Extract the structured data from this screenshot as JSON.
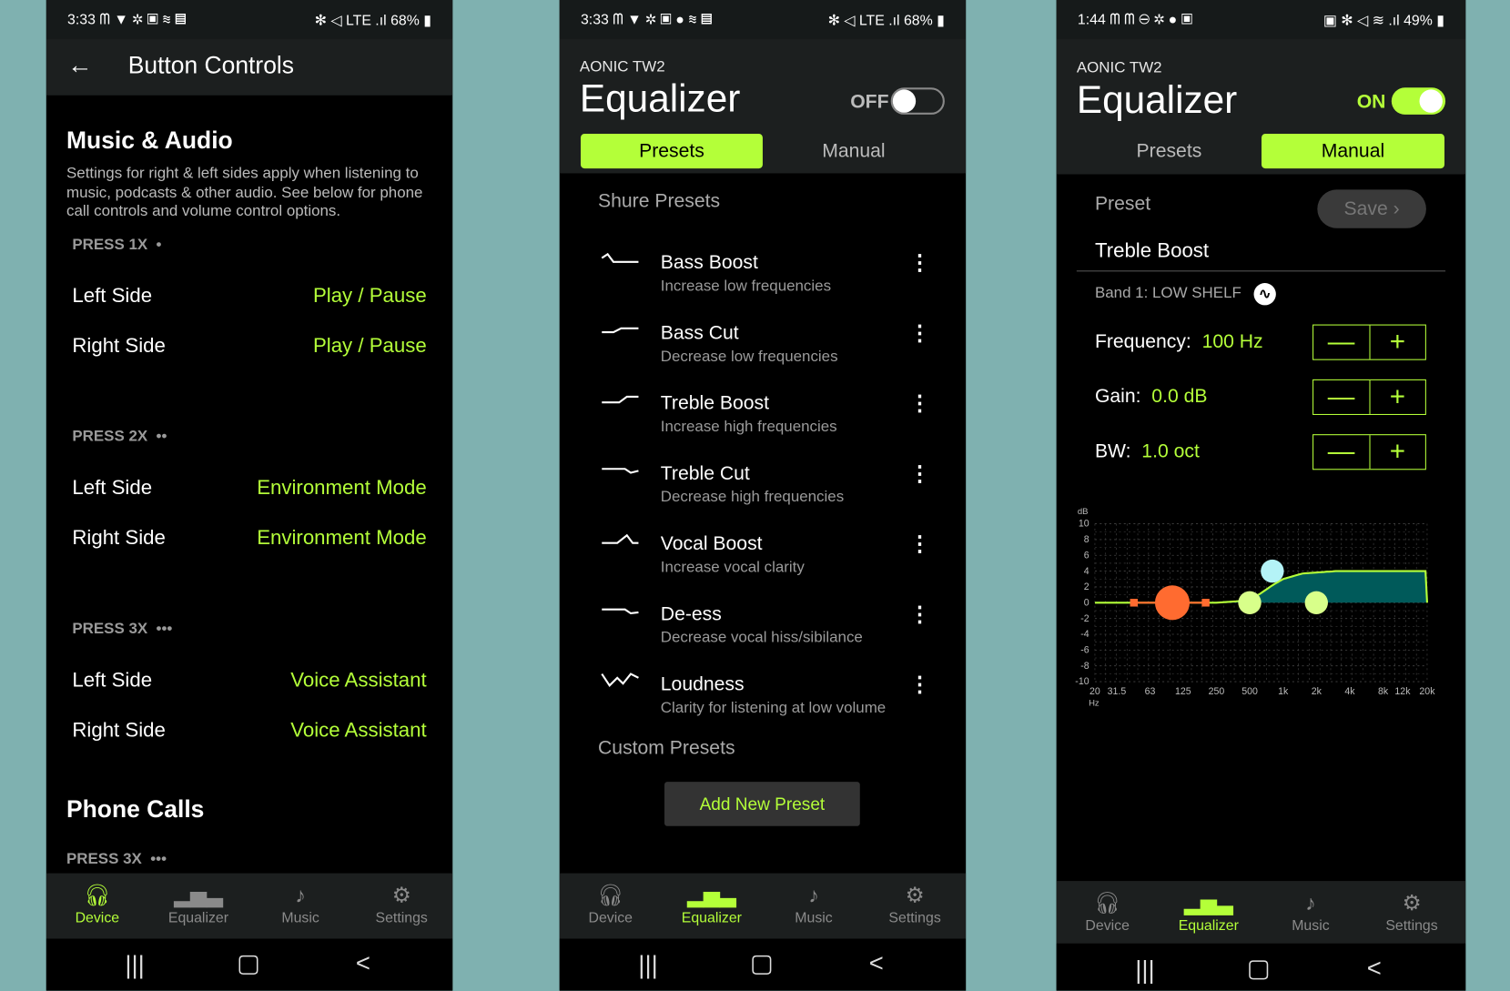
{
  "colors": {
    "accent": "#b4ff39",
    "background": "#7fb1b0",
    "panel": "#1c1f1f"
  },
  "phone1": {
    "status": {
      "time": "3:33",
      "icons_left": "ᗰ ▼ ✲ ▣ ≋ ▤",
      "icons_right": "✻ ◁ LTE .ıl",
      "battery": "68%"
    },
    "header": {
      "title": "Button Controls"
    },
    "music": {
      "title": "Music & Audio",
      "description": "Settings for right & left sides apply when listening to music, podcasts & other audio. See below for phone call controls and volume control options.",
      "groups": [
        {
          "label": "PRESS 1X",
          "dots": "•",
          "rows": [
            {
              "side": "Left Side",
              "action": "Play / Pause"
            },
            {
              "side": "Right Side",
              "action": "Play / Pause"
            }
          ]
        },
        {
          "label": "PRESS 2X",
          "dots": "••",
          "rows": [
            {
              "side": "Left Side",
              "action": "Environment Mode"
            },
            {
              "side": "Right Side",
              "action": "Environment Mode"
            }
          ]
        },
        {
          "label": "PRESS 3X",
          "dots": "•••",
          "rows": [
            {
              "side": "Left Side",
              "action": "Voice Assistant"
            },
            {
              "side": "Right Side",
              "action": "Voice Assistant"
            }
          ]
        }
      ]
    },
    "phone_calls": {
      "title": "Phone Calls",
      "press": "PRESS 3X",
      "dots": "•••"
    },
    "active_tab": "Device"
  },
  "phone2": {
    "status": {
      "time": "3:33",
      "icons_left": "ᗰ ▼ ✲ ▣ ● ≋ ▤",
      "icons_right": "✻ ◁ LTE .ıl",
      "battery": "68%"
    },
    "device": "AONIC TW2",
    "title": "Equalizer",
    "toggle_label": "OFF",
    "toggle_on": false,
    "tabs": [
      "Presets",
      "Manual"
    ],
    "active_tab": "Presets",
    "shure_presets_label": "Shure Presets",
    "presets": [
      {
        "name": "Bass Boost",
        "desc": "Increase low frequencies",
        "icon": "bass-boost-curve"
      },
      {
        "name": "Bass Cut",
        "desc": "Decrease low frequencies",
        "icon": "bass-cut-curve"
      },
      {
        "name": "Treble Boost",
        "desc": "Increase high frequencies",
        "icon": "treble-boost-curve"
      },
      {
        "name": "Treble Cut",
        "desc": "Decrease high frequencies",
        "icon": "treble-cut-curve"
      },
      {
        "name": "Vocal Boost",
        "desc": "Increase vocal clarity",
        "icon": "vocal-boost-curve"
      },
      {
        "name": "De-ess",
        "desc": "Decrease vocal hiss/sibilance",
        "icon": "de-ess-curve"
      },
      {
        "name": "Loudness",
        "desc": "Clarity for listening at low volume",
        "icon": "loudness-curve"
      }
    ],
    "custom_presets_label": "Custom Presets",
    "add_button": "Add New Preset",
    "nav_active": "Equalizer"
  },
  "phone3": {
    "status": {
      "time": "1:44",
      "icons_left": "ᗰ ᗰ ⊖ ✲ ● ▣",
      "icons_right": "▣ ✻ ◁ ≋ .ıl",
      "battery": "49%"
    },
    "device": "AONIC TW2",
    "title": "Equalizer",
    "toggle_label": "ON",
    "toggle_on": true,
    "tabs": [
      "Presets",
      "Manual"
    ],
    "active_tab": "Manual",
    "preset_label": "Preset",
    "save_button": "Save",
    "preset_name": "Treble Boost",
    "band_label": "Band 1: LOW SHELF",
    "params": [
      {
        "label": "Frequency:",
        "value": "100",
        "unit": "Hz"
      },
      {
        "label": "Gain:",
        "value": "0.0",
        "unit": "dB"
      },
      {
        "label": "BW:",
        "value": "1.0",
        "unit": "oct"
      }
    ],
    "stepper": {
      "minus": "—",
      "plus": "+"
    },
    "nav_active": "Equalizer"
  },
  "nav": [
    {
      "label": "Device",
      "icon": "headphones-icon"
    },
    {
      "label": "Equalizer",
      "icon": "equalizer-icon"
    },
    {
      "label": "Music",
      "icon": "music-note-icon"
    },
    {
      "label": "Settings",
      "icon": "gear-icon"
    }
  ],
  "chart_data": {
    "type": "line",
    "ylabel": "dB",
    "xlabel": "Hz",
    "x_scale": "log",
    "xlim": [
      20,
      20000
    ],
    "ylim": [
      -10,
      10
    ],
    "grid": true,
    "yticks": [
      "10",
      "8",
      "6",
      "4",
      "2",
      "0",
      "-2",
      "-4",
      "-6",
      "-8",
      "-10"
    ],
    "xticks": [
      {
        "v": 20,
        "l": "20"
      },
      {
        "v": 31.5,
        "l": "31.5"
      },
      {
        "v": 63,
        "l": "63"
      },
      {
        "v": 125,
        "l": "125"
      },
      {
        "v": 250,
        "l": "250"
      },
      {
        "v": 500,
        "l": "500"
      },
      {
        "v": 1000,
        "l": "1k"
      },
      {
        "v": 2000,
        "l": "2k"
      },
      {
        "v": 4000,
        "l": "4k"
      },
      {
        "v": 8000,
        "l": "8k"
      },
      {
        "v": 12000,
        "l": "12k"
      },
      {
        "v": 20000,
        "l": "20k"
      }
    ],
    "response_curve": [
      [
        20,
        0
      ],
      [
        250,
        0
      ],
      [
        400,
        0.2
      ],
      [
        600,
        1
      ],
      [
        800,
        2.2
      ],
      [
        1000,
        3
      ],
      [
        1500,
        3.7
      ],
      [
        3000,
        4
      ],
      [
        20000,
        4
      ]
    ],
    "band_points": [
      {
        "freq": 100,
        "gain": 0,
        "color": "#ff6b30",
        "selected": true
      },
      {
        "freq": 500,
        "gain": 0,
        "color": "#d8ff8a"
      },
      {
        "freq": 800,
        "gain": 4,
        "color": "#b4f3f7"
      },
      {
        "freq": 2000,
        "gain": 0,
        "color": "#d8ff8a"
      }
    ],
    "bandwidth_handles": [
      45,
      200
    ],
    "fill_color": "#005a5a",
    "curve_color": "#b4ff39"
  }
}
